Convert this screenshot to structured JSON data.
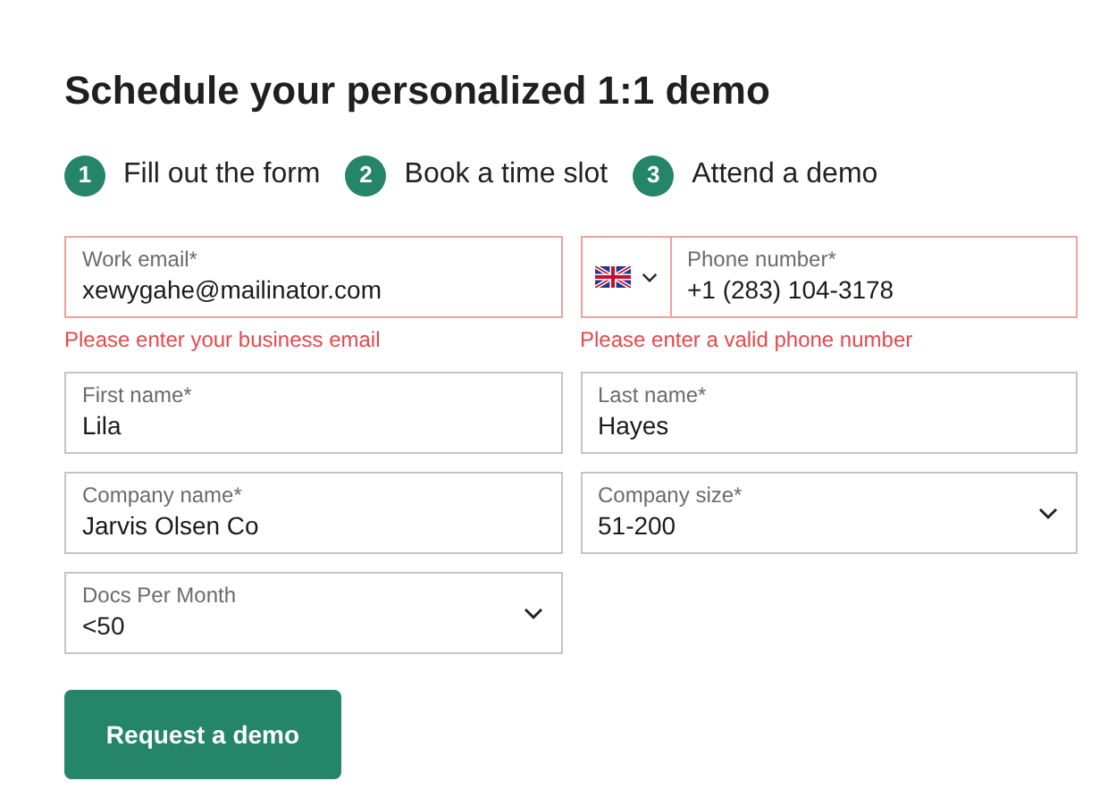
{
  "title": "Schedule your personalized 1:1 demo",
  "steps": [
    {
      "number": "1",
      "label": "Fill out the form"
    },
    {
      "number": "2",
      "label": "Book a time slot"
    },
    {
      "number": "3",
      "label": "Attend a demo"
    }
  ],
  "rows": [
    [
      {
        "kind": "text",
        "label": "Work email*",
        "value": "xewygahe@mailinator.com",
        "error": "Please enter your business email"
      },
      {
        "kind": "phone",
        "label": "Phone number*",
        "value": "+1 (283) 104-3178",
        "error": "Please enter a valid phone number"
      }
    ],
    [
      {
        "kind": "text",
        "label": "First name*",
        "value": "Lila"
      },
      {
        "kind": "text",
        "label": "Last name*",
        "value": "Hayes"
      }
    ],
    [
      {
        "kind": "text",
        "label": "Company name*",
        "value": "Jarvis Olsen Co"
      },
      {
        "kind": "select",
        "label": "Company size*",
        "value": "51-200"
      }
    ],
    [
      {
        "kind": "select",
        "label": "Docs Per Month",
        "value": "<50"
      }
    ]
  ],
  "submit": "Request a demo"
}
